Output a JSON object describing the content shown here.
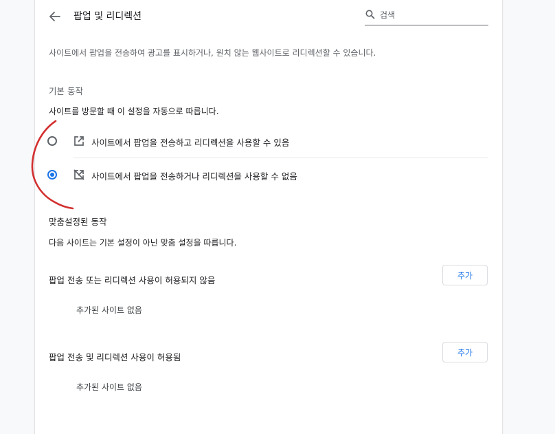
{
  "header": {
    "title": "팝업 및 리디렉션",
    "search_placeholder": "검색"
  },
  "description": "사이트에서 팝업을 전송하여 광고를 표시하거나, 원치 않는 웹사이트로 리디렉션할 수 있습니다.",
  "default_behavior": {
    "heading": "기본 동작",
    "subheading": "사이트를 방문할 때 이 설정을 자동으로 따릅니다.",
    "options": [
      {
        "label": "사이트에서 팝업을 전송하고 리디렉션을 사용할 수 있음",
        "icon": "open-in-new-icon",
        "selected": false
      },
      {
        "label": "사이트에서 팝업을 전송하거나 리디렉션을 사용할 수 없음",
        "icon": "open-in-new-off-icon",
        "selected": true
      }
    ]
  },
  "custom_behavior": {
    "heading": "맞춤설정된 동작",
    "subheading": "다음 사이트는 기본 설정이 아닌 맞춤 설정을 따릅니다.",
    "lists": [
      {
        "title": "팝업 전송 또는 리디렉션 사용이 허용되지 않음",
        "add_label": "추가",
        "empty_text": "추가된 사이트 없음"
      },
      {
        "title": "팝업 전송 및 리디렉션 사용이 허용됨",
        "add_label": "추가",
        "empty_text": "추가된 사이트 없음"
      }
    ]
  },
  "colors": {
    "accent": "#1a73e8",
    "annotation": "#d32f2f"
  }
}
